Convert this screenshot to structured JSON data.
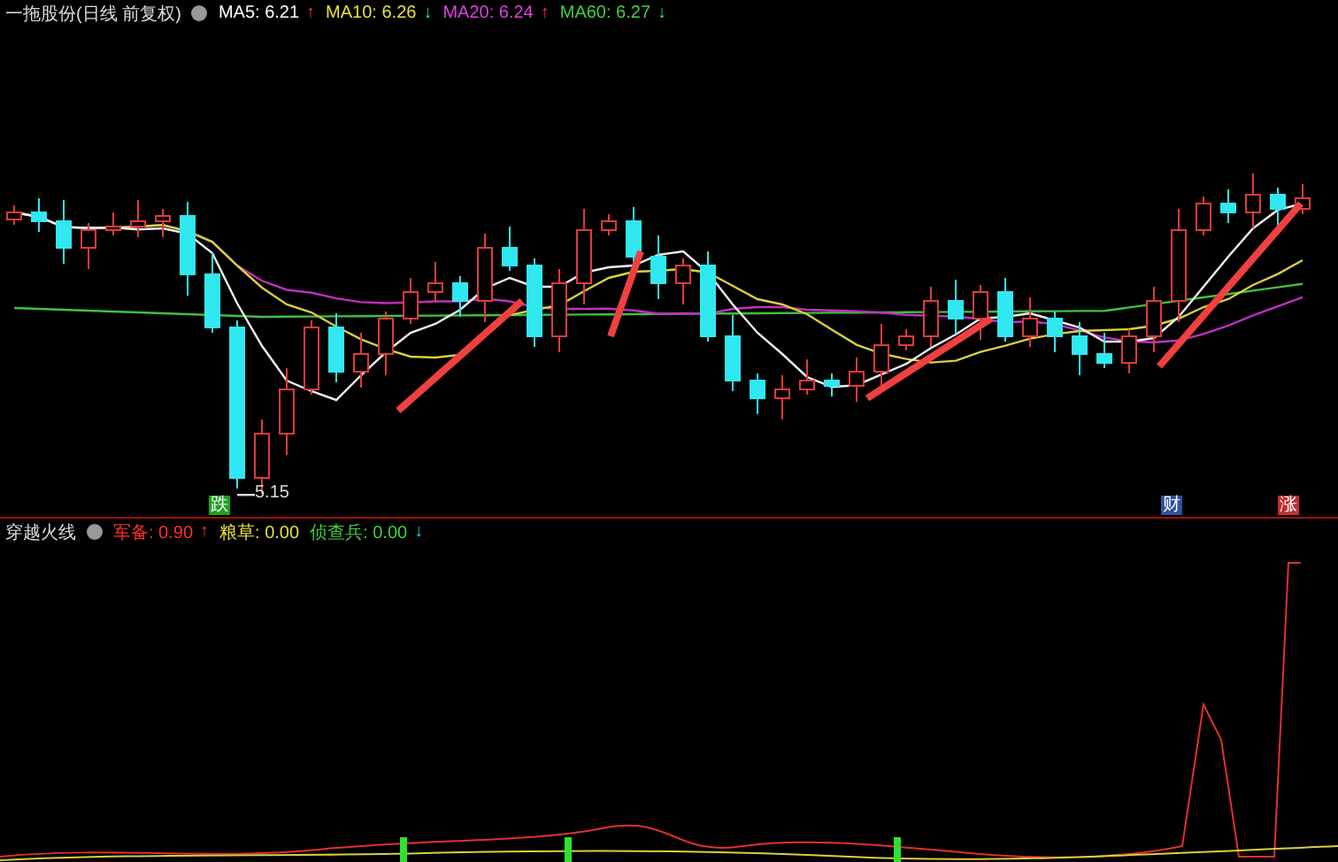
{
  "main_panel": {
    "title": "一拖股份(日线 前复权)",
    "indicators": [
      {
        "text": "MA5: 6.21",
        "arrow": "↑",
        "rising": true,
        "color": "#ffffff"
      },
      {
        "text": "MA10: 6.26",
        "arrow": "↓",
        "rising": false,
        "color": "#e8e040"
      },
      {
        "text": "MA20: 6.24",
        "arrow": "↑",
        "rising": true,
        "color": "#e040e0"
      },
      {
        "text": "MA60: 6.27",
        "arrow": "↓",
        "rising": false,
        "color": "#40d040"
      }
    ],
    "low_label": "5.15",
    "markers": [
      {
        "text": "跌",
        "color": "#20a020"
      },
      {
        "text": "财",
        "color": "#3050a0"
      },
      {
        "text": "涨",
        "color": "#c03030"
      }
    ]
  },
  "sub_panel": {
    "title": "穿越火线",
    "indicators": [
      {
        "text": "军备: 0.90",
        "arrow": "↑",
        "rising": true,
        "color": "#ff3030"
      },
      {
        "text": "粮草: 0.00",
        "color": "#e8e040"
      },
      {
        "text": "侦查兵: 0.00",
        "arrow": "↓",
        "rising": false,
        "color": "#40d040"
      }
    ]
  }
}
